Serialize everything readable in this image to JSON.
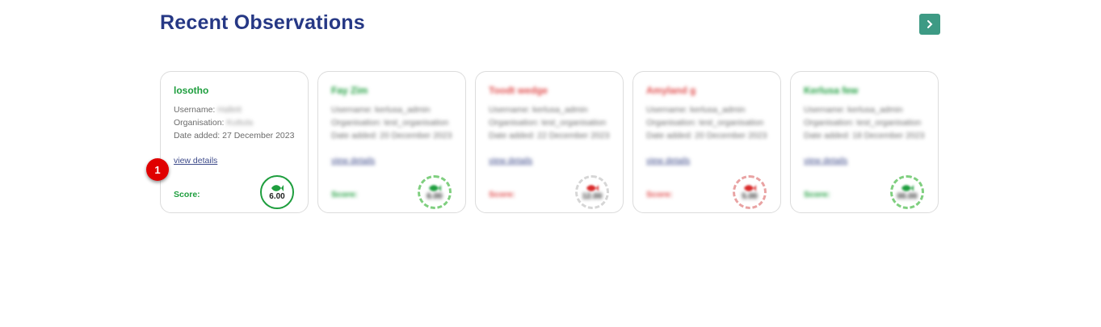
{
  "section": {
    "title": "Recent Observations"
  },
  "colors": {
    "green": "#1e9e3e",
    "red": "#e04c4c",
    "accent": "#3d9a84",
    "title": "#263885"
  },
  "cards": [
    {
      "title": "losotho",
      "username_label": "Username:",
      "username_value": "Hallett",
      "org_label": "Organisation:",
      "org_value": "Kuttula",
      "date_line": "Date added: 27 December 2023",
      "details": "view details",
      "score_label": "Score:",
      "score": "6.00",
      "tone": "green",
      "icon": "fish-icon"
    },
    {
      "title": "Fay Zim",
      "username_label": "Username:",
      "username_value": "kerlusa_admin",
      "org_label": "Organisation:",
      "org_value": "test_organisation",
      "date_line": "Date added: 20 December 2023",
      "details": "view details",
      "score_label": "Score:",
      "score": "6.00",
      "tone": "green",
      "icon": "fish-icon"
    },
    {
      "title": "Toodt wedge",
      "username_label": "Username:",
      "username_value": "kerlusa_admin",
      "org_label": "Organisation:",
      "org_value": "test_organisation",
      "date_line": "Date added: 22 December 2023",
      "details": "view details",
      "score_label": "Score:",
      "score": "12.00",
      "tone": "red",
      "icon": "fish-icon"
    },
    {
      "title": "Amyland g",
      "username_label": "Username:",
      "username_value": "kerlusa_admin",
      "org_label": "Organisation:",
      "org_value": "test_organisation",
      "date_line": "Date added: 20 December 2023",
      "details": "view details",
      "score_label": "Score:",
      "score": "5.00",
      "tone": "red",
      "icon": "fish-icon"
    },
    {
      "title": "Kerlusa few",
      "username_label": "Username:",
      "username_value": "kerlusa_admin",
      "org_label": "Organisation:",
      "org_value": "test_organisation",
      "date_line": "Date added: 18 December 2023",
      "details": "view details",
      "score_label": "Score:",
      "score": "00.00",
      "tone": "green",
      "icon": "fish-icon"
    }
  ],
  "annotation": {
    "badge": "1"
  }
}
